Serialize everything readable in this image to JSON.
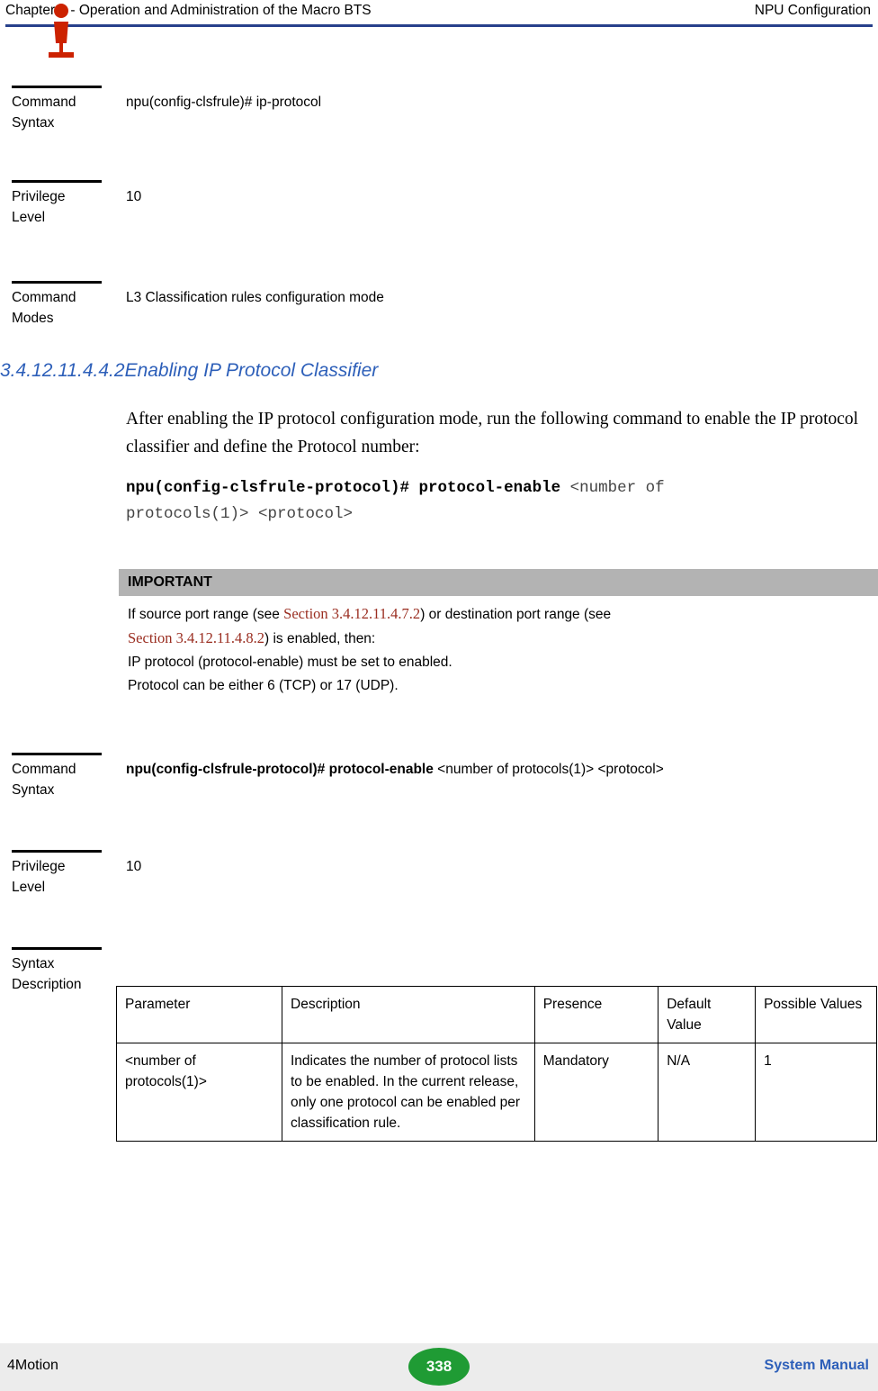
{
  "header": {
    "left": "Chapter 3 - Operation and Administration of the Macro BTS",
    "right": "NPU Configuration"
  },
  "blocks": {
    "cmd_syntax_1": {
      "label_line1": "Command",
      "label_line2": "Syntax",
      "value": "npu(config-clsfrule)# ip-protocol"
    },
    "privilege_1": {
      "label_line1": "Privilege",
      "label_line2": "Level",
      "value": "10"
    },
    "cmd_modes_1": {
      "label_line1": "Command",
      "label_line2": "Modes",
      "value": "L3 Classification rules configuration mode"
    },
    "cmd_syntax_2": {
      "label_line1": "Command",
      "label_line2": "Syntax",
      "value_bold": "npu(config-clsfrule-protocol)# protocol-enable",
      "value_normal": " <number of protocols(1)> <protocol>"
    },
    "privilege_2": {
      "label_line1": "Privilege",
      "label_line2": "Level",
      "value": "10"
    },
    "syntax_desc": {
      "label_line1": "Syntax",
      "label_line2": "Description"
    }
  },
  "section": {
    "number": "3.4.12.11.4.4.2",
    "title": "Enabling IP Protocol Classifier"
  },
  "paragraph": "After enabling the IP protocol configuration mode, run the following command to enable the IP protocol classifier and define the Protocol number:",
  "code": {
    "line1_bold": "npu(config-clsfrule-protocol)# protocol-enable",
    "line1_arg": " <number of",
    "line2_arg": "protocols(1)> <protocol>"
  },
  "note": {
    "title": "IMPORTANT",
    "icon": "info-icon",
    "line1_pre": "If source port range (see ",
    "line1_link1": "Section 3.4.12.11.4.7.2",
    "line1_mid": ") or destination port range (see ",
    "line2_link2": "Section 3.4.12.11.4.8.2",
    "line2_post": ") is enabled, then:",
    "line3": "IP protocol (protocol-enable) must be set to enabled.",
    "line4": "Protocol can be either 6 (TCP) or 17 (UDP)."
  },
  "param_table": {
    "headers": [
      "Parameter",
      "Description",
      "Presence",
      "Default Value",
      "Possible Values"
    ],
    "header_cells": {
      "c0": "Parameter",
      "c1": "Description",
      "c2": "Presence",
      "c3": "Default Value",
      "c4": "Possible Values"
    },
    "rows": [
      {
        "parameter": "<number of protocols(1)>",
        "description": "Indicates the number of protocol lists to be enabled. In the current release, only one protocol can be enabled per classification rule.",
        "presence": "Mandatory",
        "default_value": "N/A",
        "possible_values": "1"
      }
    ]
  },
  "footer": {
    "left": "4Motion",
    "page_number": "338",
    "right": "System Manual"
  }
}
